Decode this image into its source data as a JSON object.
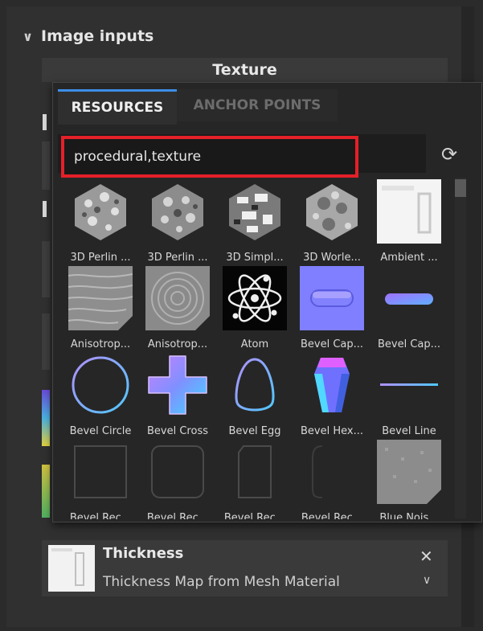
{
  "section": {
    "title": "Image inputs",
    "collapse_icon": "chevron-down-icon"
  },
  "texture_header": "Texture",
  "tabs": [
    {
      "label": "RESOURCES",
      "active": true
    },
    {
      "label": "ANCHOR POINTS",
      "active": false
    }
  ],
  "search": {
    "value": "procedural,texture",
    "highlight_color": "#e42028"
  },
  "reload_icon": "reload-icon",
  "resources": [
    "3D Perlin ...",
    "3D Perlin ...",
    "3D Simpl...",
    "3D Worle...",
    "Ambient ...",
    "Anisotrop...",
    "Anisotrop...",
    "Atom",
    "Bevel Cap...",
    "Bevel Cap...",
    "Bevel Circle",
    "Bevel Cross",
    "Bevel Egg",
    "Bevel Hex...",
    "Bevel Line",
    "Bevel Rec...",
    "Bevel Rec...",
    "Bevel Rec...",
    "Bevel Rec...",
    "Blue Nois..."
  ],
  "thickness": {
    "title": "Thickness",
    "subtitle": "Thickness Map from Mesh Material"
  },
  "colors": {
    "accent": "#3d8ee8",
    "panel": "#262626",
    "background": "#303030"
  }
}
